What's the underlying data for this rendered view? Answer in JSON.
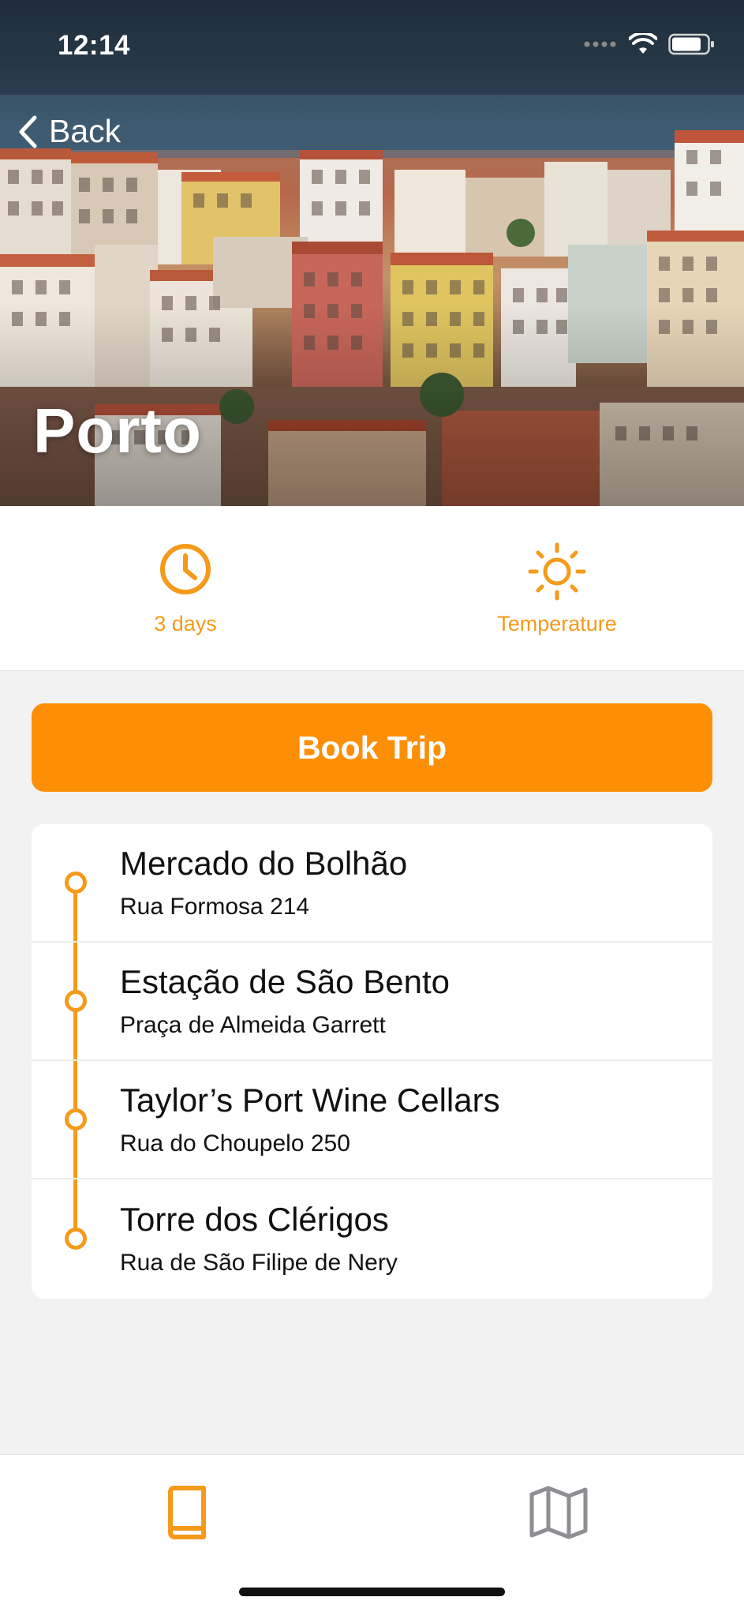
{
  "status_bar": {
    "time": "12:14"
  },
  "nav": {
    "back_label": "Back"
  },
  "hero": {
    "title": "Porto"
  },
  "info": {
    "duration": {
      "label": "3 days",
      "icon": "clock-icon"
    },
    "weather": {
      "label": "Temperature",
      "icon": "sun-icon"
    }
  },
  "actions": {
    "book_label": "Book Trip"
  },
  "stops": [
    {
      "name": "Mercado do Bolhão",
      "address": "Rua Formosa 214"
    },
    {
      "name": "Estação de São Bento",
      "address": "Praça de Almeida Garrett"
    },
    {
      "name": "Taylor’s Port Wine Cellars",
      "address": "Rua do Choupelo 250"
    },
    {
      "name": "Torre dos Clérigos",
      "address": "Rua de São Filipe de Nery"
    }
  ],
  "tabs": [
    {
      "icon": "book-icon",
      "active": true
    },
    {
      "icon": "map-icon",
      "active": false
    }
  ],
  "colors": {
    "accent": "#fd8f06",
    "icon_accent": "#f59a1a",
    "inactive": "#8e8e93"
  }
}
